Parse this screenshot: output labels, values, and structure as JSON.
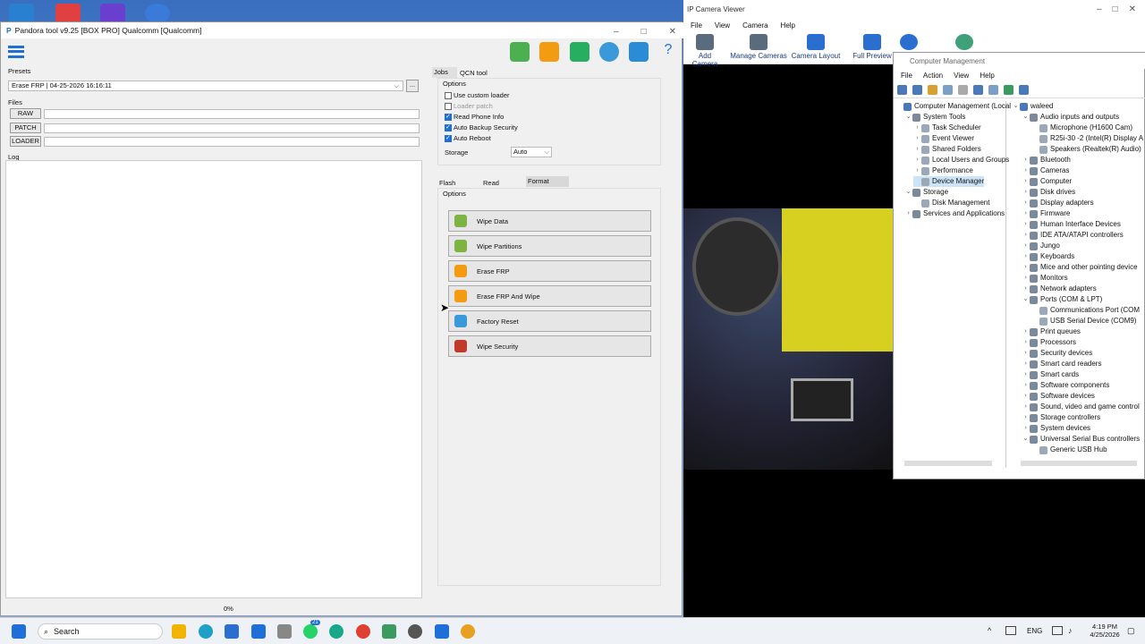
{
  "desktop": {
    "icons": [
      "folder-icon",
      "eft-icon",
      "z-icon",
      "settings-icon"
    ]
  },
  "ipcam": {
    "title": "IP Camera Viewer",
    "menu": [
      "File",
      "View",
      "Camera",
      "Help"
    ],
    "toolbar": [
      {
        "label": "Add Camera",
        "icon": "add-camera-icon"
      },
      {
        "label": "Manage Cameras",
        "icon": "manage-cameras-icon"
      },
      {
        "label": "Camera Layout",
        "icon": "layout-icon"
      },
      {
        "label": "Full Preview",
        "icon": "full-preview-icon"
      },
      {
        "label": "",
        "icon": "help-icon"
      },
      {
        "label": "",
        "icon": "globe-icon"
      }
    ]
  },
  "compmgmt": {
    "title": "Computer Management",
    "menu": [
      "File",
      "Action",
      "View",
      "Help"
    ],
    "tree": [
      {
        "label": "Computer Management (Local",
        "level": 0,
        "arrow": ""
      },
      {
        "label": "System Tools",
        "level": 1,
        "arrow": "v"
      },
      {
        "label": "Task Scheduler",
        "level": 2,
        "arrow": ">"
      },
      {
        "label": "Event Viewer",
        "level": 2,
        "arrow": ">"
      },
      {
        "label": "Shared Folders",
        "level": 2,
        "arrow": ">"
      },
      {
        "label": "Local Users and Groups",
        "level": 2,
        "arrow": ">"
      },
      {
        "label": "Performance",
        "level": 2,
        "arrow": ">"
      },
      {
        "label": "Device Manager",
        "level": 2,
        "arrow": "",
        "selected": true
      },
      {
        "label": "Storage",
        "level": 1,
        "arrow": "v"
      },
      {
        "label": "Disk Management",
        "level": 2,
        "arrow": ""
      },
      {
        "label": "Services and Applications",
        "level": 1,
        "arrow": ">"
      }
    ],
    "devices": [
      {
        "label": "waleed",
        "level": 0,
        "arrow": "v"
      },
      {
        "label": "Audio inputs and outputs",
        "level": 1,
        "arrow": "v"
      },
      {
        "label": "Microphone (H1600 Cam)",
        "level": 2,
        "arrow": ""
      },
      {
        "label": "R25i-30 -2 (Intel(R) Display A",
        "level": 2,
        "arrow": ""
      },
      {
        "label": "Speakers (Realtek(R) Audio)",
        "level": 2,
        "arrow": ""
      },
      {
        "label": "Bluetooth",
        "level": 1,
        "arrow": ">"
      },
      {
        "label": "Cameras",
        "level": 1,
        "arrow": ">"
      },
      {
        "label": "Computer",
        "level": 1,
        "arrow": ">"
      },
      {
        "label": "Disk drives",
        "level": 1,
        "arrow": ">"
      },
      {
        "label": "Display adapters",
        "level": 1,
        "arrow": ">"
      },
      {
        "label": "Firmware",
        "level": 1,
        "arrow": ">"
      },
      {
        "label": "Human Interface Devices",
        "level": 1,
        "arrow": ">"
      },
      {
        "label": "IDE ATA/ATAPI controllers",
        "level": 1,
        "arrow": ">"
      },
      {
        "label": "Jungo",
        "level": 1,
        "arrow": ">"
      },
      {
        "label": "Keyboards",
        "level": 1,
        "arrow": ">"
      },
      {
        "label": "Mice and other pointing device",
        "level": 1,
        "arrow": ">"
      },
      {
        "label": "Monitors",
        "level": 1,
        "arrow": ">"
      },
      {
        "label": "Network adapters",
        "level": 1,
        "arrow": ">"
      },
      {
        "label": "Ports (COM & LPT)",
        "level": 1,
        "arrow": "v"
      },
      {
        "label": "Communications Port (COM",
        "level": 2,
        "arrow": ""
      },
      {
        "label": "USB Serial Device (COM9)",
        "level": 2,
        "arrow": ""
      },
      {
        "label": "Print queues",
        "level": 1,
        "arrow": ">"
      },
      {
        "label": "Processors",
        "level": 1,
        "arrow": ">"
      },
      {
        "label": "Security devices",
        "level": 1,
        "arrow": ">"
      },
      {
        "label": "Smart card readers",
        "level": 1,
        "arrow": ">"
      },
      {
        "label": "Smart cards",
        "level": 1,
        "arrow": ">"
      },
      {
        "label": "Software components",
        "level": 1,
        "arrow": ">"
      },
      {
        "label": "Software devices",
        "level": 1,
        "arrow": ">"
      },
      {
        "label": "Sound, video and game control",
        "level": 1,
        "arrow": ">"
      },
      {
        "label": "Storage controllers",
        "level": 1,
        "arrow": ">"
      },
      {
        "label": "System devices",
        "level": 1,
        "arrow": ">"
      },
      {
        "label": "Universal Serial Bus controllers",
        "level": 1,
        "arrow": "v"
      },
      {
        "label": "Generic USB Hub",
        "level": 2,
        "arrow": ""
      }
    ]
  },
  "pandora": {
    "title": "Pandora tool v9.25 [BOX PRO] Qualcomm [Qualcomm]",
    "presets_label": "Presets",
    "preset_value": "Erase FRP | 04-25-2026 16:16:11",
    "preset_btn": "...",
    "files_label": "Files",
    "file_buttons": [
      "RAW",
      "PATCH",
      "LOADER"
    ],
    "log_label": "Log",
    "progress": "0%",
    "top_tabs": [
      "Jobs",
      "QCN tool"
    ],
    "options_label": "Options",
    "options": [
      {
        "label": "Use custom loader",
        "checked": false,
        "disabled": false
      },
      {
        "label": "Loader patch",
        "checked": false,
        "disabled": true
      },
      {
        "label": "Read Phone Info",
        "checked": true,
        "disabled": false
      },
      {
        "label": "Auto Backup Security",
        "checked": true,
        "disabled": false
      },
      {
        "label": "Auto Reboot",
        "checked": true,
        "disabled": false
      }
    ],
    "storage_label": "Storage",
    "storage_value": "Auto",
    "sub_tabs": [
      "Flash",
      "Read",
      "Format"
    ],
    "sub_options_label": "Options",
    "actions": [
      {
        "label": "Wipe Data",
        "icon": "android-icon"
      },
      {
        "label": "Wipe Partitions",
        "icon": "android-icon"
      },
      {
        "label": "Erase FRP",
        "icon": "frp-icon"
      },
      {
        "label": "Erase FRP And Wipe",
        "icon": "frp-icon"
      },
      {
        "label": "Factory Reset",
        "icon": "reset-icon"
      },
      {
        "label": "Wipe Security",
        "icon": "shield-icon"
      }
    ],
    "toolbar_icons": [
      "save-icon",
      "download-icon",
      "sheet-icon",
      "gear-icon",
      "telegram-icon",
      "help-icon"
    ]
  },
  "taskbar": {
    "search": "Search",
    "lang": "ENG",
    "time": "4:19 PM",
    "date": "4/25/2026",
    "badge": "21"
  },
  "colors": {
    "accent": "#1f6fd8",
    "android": "#7cb342",
    "frp": "#f39c12"
  }
}
